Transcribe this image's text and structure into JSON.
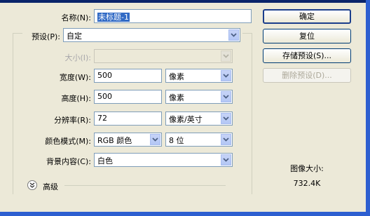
{
  "form": {
    "name_label": "名称(N):",
    "name_value": "未标题-1",
    "preset_label": "预设(P):",
    "preset_value": "自定",
    "size_label": "大小(I):",
    "size_value": "",
    "width_label": "宽度(W):",
    "width_value": "500",
    "width_unit": "像素",
    "height_label": "高度(H):",
    "height_value": "500",
    "height_unit": "像素",
    "resolution_label": "分辨率(R):",
    "resolution_value": "72",
    "resolution_unit": "像素/英寸",
    "color_mode_label": "颜色模式(M):",
    "color_mode_value": "RGB 颜色",
    "bit_depth_value": "8 位",
    "background_label": "背景内容(C):",
    "background_value": "白色",
    "advanced_label": "高级"
  },
  "buttons": {
    "ok": "确定",
    "reset": "复位",
    "save_preset": "存储预设(S)...",
    "delete_preset": "删除预设(D)..."
  },
  "info": {
    "image_size_label": "图像大小:",
    "image_size_value": "732.4K"
  },
  "icons": {
    "dropdown": "chevron-down-icon",
    "advanced": "double-chevron-down-icon"
  },
  "colors": {
    "selection": "#316ac5",
    "window_frame": "#2d5fd0",
    "dialog_bg": "#ece9d8"
  }
}
